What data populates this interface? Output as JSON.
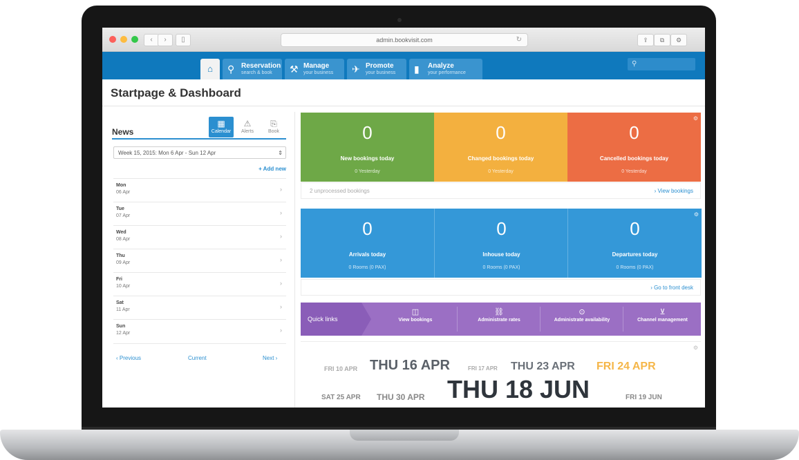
{
  "browser": {
    "url": "admin.bookvisit.com",
    "back_glyph": "‹",
    "forward_glyph": "›",
    "sidebar_glyph": "▯",
    "reload_glyph": "↻",
    "right_buttons": [
      "⇪",
      "⧉",
      "⚙"
    ]
  },
  "nav": {
    "home_glyph": "⌂",
    "tabs": [
      {
        "title": "Reservation",
        "subtitle": "search & book",
        "icon": "⚲",
        "icon_name": "reservation-icon"
      },
      {
        "title": "Manage",
        "subtitle": "your business",
        "icon": "⚒",
        "icon_name": "manage-icon"
      },
      {
        "title": "Promote",
        "subtitle": "your business",
        "icon": "✈",
        "icon_name": "promote-icon"
      },
      {
        "title": "Analyze",
        "subtitle": "your performance",
        "icon": "▮",
        "icon_name": "analyze-icon"
      }
    ],
    "search_glyph": "⚲"
  },
  "page": {
    "title": "Startpage & Dashboard"
  },
  "news": {
    "title": "News",
    "tabs": [
      {
        "label": "Calendar",
        "glyph": "▦",
        "active": true
      },
      {
        "label": "Alerts",
        "glyph": "⚠",
        "active": false
      },
      {
        "label": "Book",
        "glyph": "⎘",
        "active": false
      }
    ],
    "week_select": "Week 15, 2015: Mon 6 Apr - Sun 12 Apr",
    "add_new": "+ Add new",
    "days": [
      {
        "name": "Mon",
        "date": "06 Apr"
      },
      {
        "name": "Tue",
        "date": "07 Apr"
      },
      {
        "name": "Wed",
        "date": "08 Apr"
      },
      {
        "name": "Thu",
        "date": "09 Apr"
      },
      {
        "name": "Fri",
        "date": "10 Apr"
      },
      {
        "name": "Sat",
        "date": "11 Apr"
      },
      {
        "name": "Sun",
        "date": "12 Apr"
      }
    ],
    "previous": "‹ Previous",
    "current": "Current",
    "next": "Next ›"
  },
  "bookings": {
    "cards": [
      {
        "value": "0",
        "label": "New bookings today",
        "sub": "0 Yesterday",
        "color": "#6ea847"
      },
      {
        "value": "0",
        "label": "Changed bookings today",
        "sub": "0 Yesterday",
        "color": "#f3b03f"
      },
      {
        "value": "0",
        "label": "Cancelled bookings today",
        "sub": "0 Yesterday",
        "color": "#ec6d44"
      }
    ],
    "footer_left": "2 unprocessed bookings",
    "footer_right": "› View bookings"
  },
  "frontdesk": {
    "cards": [
      {
        "value": "0",
        "label": "Arrivals today",
        "sub": "0 Rooms (0 PAX)",
        "color": "#3498d8"
      },
      {
        "value": "0",
        "label": "Inhouse today",
        "sub": "0 Rooms (0 PAX)",
        "color": "#3498d8"
      },
      {
        "value": "0",
        "label": "Departures today",
        "sub": "0 Rooms (0 PAX)",
        "color": "#3498d8"
      }
    ],
    "footer_right": "› Go to front desk"
  },
  "quick_links": {
    "label": "Quick links",
    "items": [
      {
        "label": "View bookings",
        "glyph": "◫",
        "icon_name": "view-bookings-icon"
      },
      {
        "label": "Administrate rates",
        "glyph": "⛓",
        "icon_name": "rates-icon"
      },
      {
        "label": "Administrate availability",
        "glyph": "⊙",
        "icon_name": "availability-icon"
      },
      {
        "label": "Channel management",
        "glyph": "⊻",
        "icon_name": "channel-icon"
      }
    ]
  },
  "dates": {
    "row1": [
      "FRI 10 APR",
      "THU 16 APR",
      "FRI 17 APR",
      "THU 23 APR",
      "FRI 24 APR"
    ],
    "row2": [
      "SAT 25 APR",
      "THU 30 APR",
      "THU 18 JUN",
      "FRI 19 JUN"
    ],
    "accent": "#f5b648"
  },
  "colors": {
    "brand_blue": "#0f79bd",
    "purple": "#9b6fc4"
  }
}
